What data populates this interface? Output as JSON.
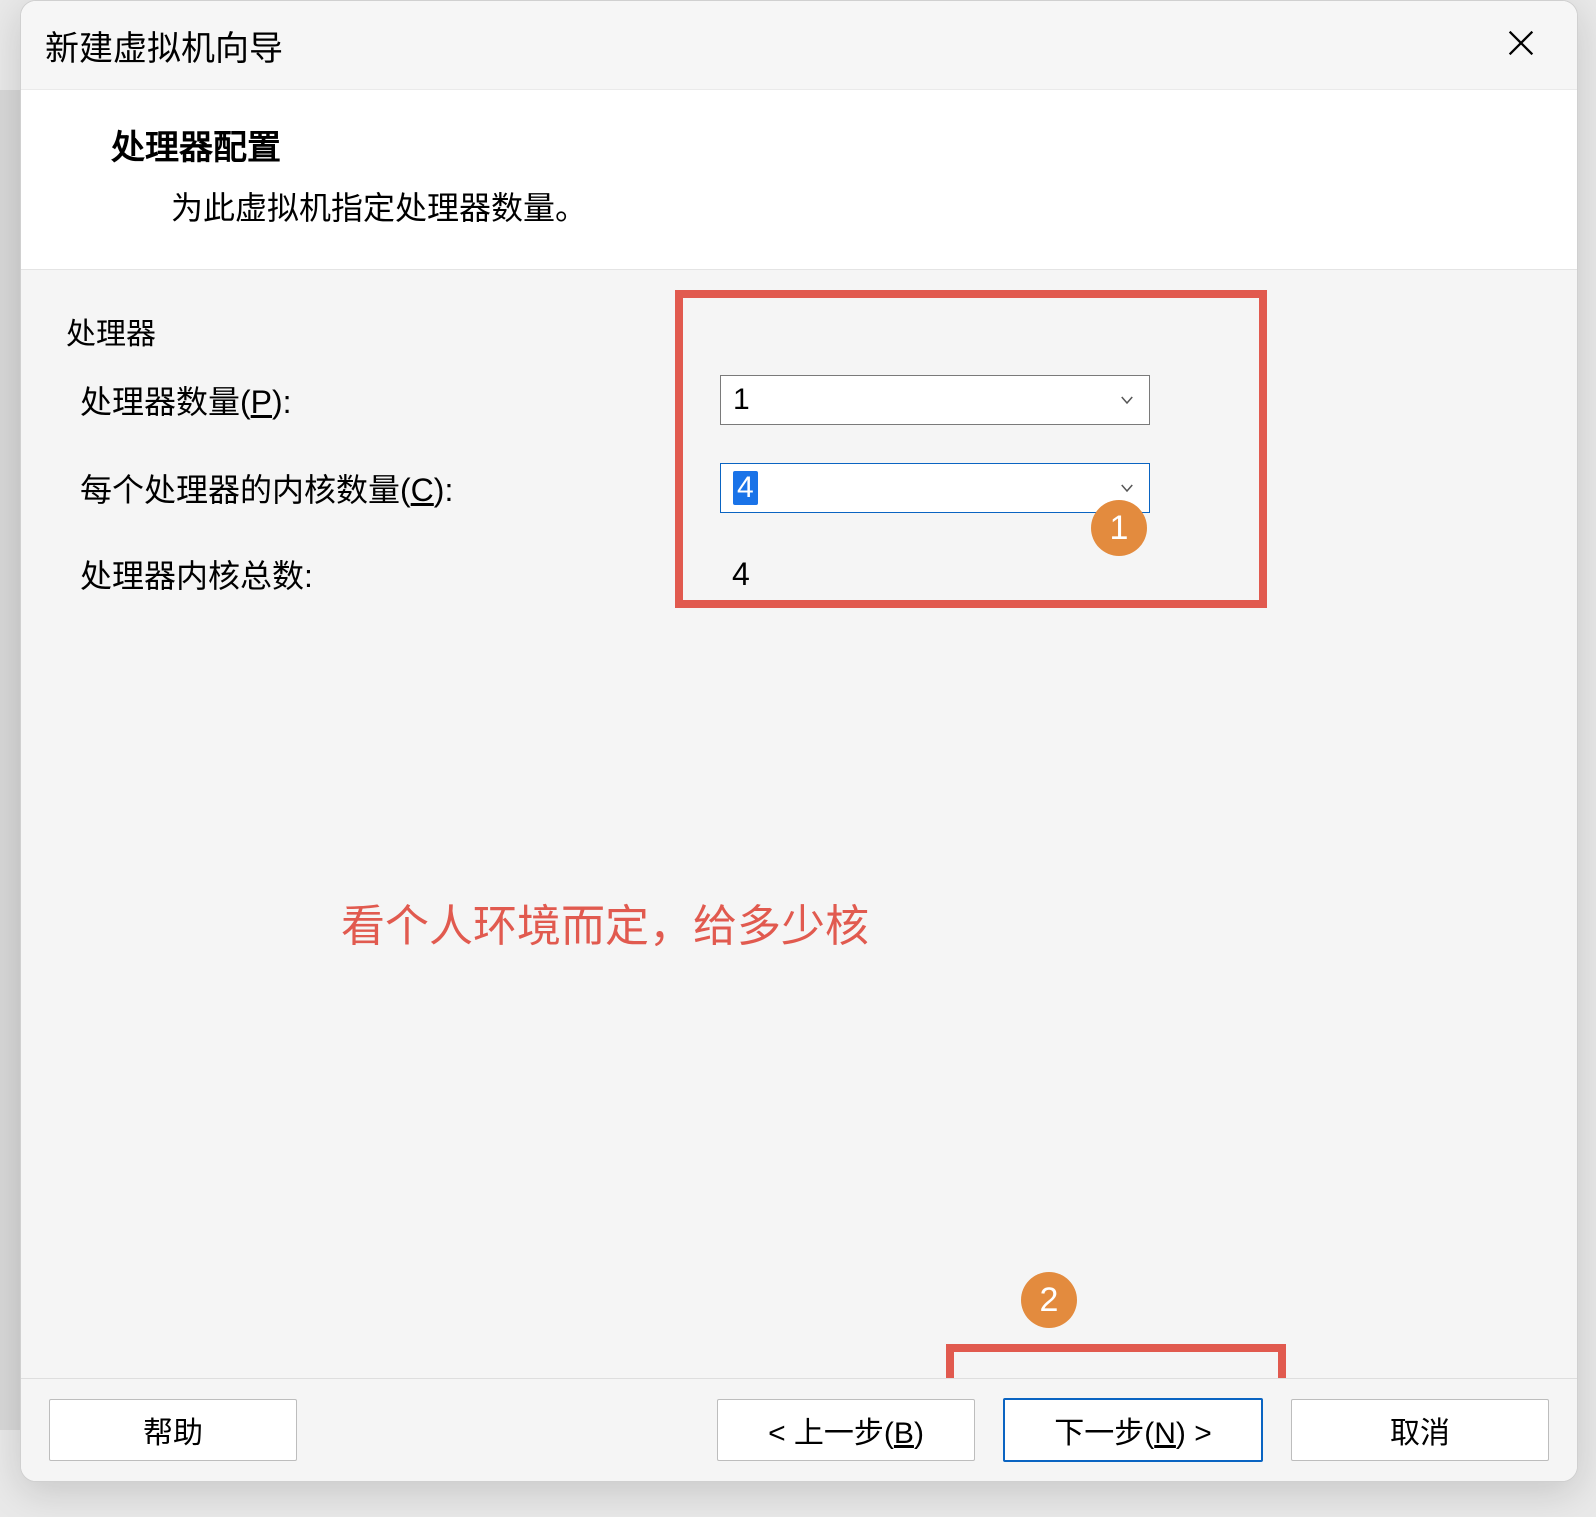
{
  "titlebar": {
    "title": "新建虚拟机向导"
  },
  "header": {
    "title": "处理器配置",
    "subtitle": "为此虚拟机指定处理器数量。"
  },
  "group": {
    "legend": "处理器",
    "rows": {
      "processors": {
        "label_pre": "处理器数量(",
        "label_key": "P",
        "label_post": "):",
        "value": "1"
      },
      "cores": {
        "label_pre": "每个处理器的内核数量(",
        "label_key": "C",
        "label_post": "):",
        "value": "4"
      },
      "total": {
        "label": "处理器内核总数:",
        "value": "4"
      }
    }
  },
  "annotations": {
    "hint": "看个人环境而定，给多少核",
    "badge1": "1",
    "badge2": "2"
  },
  "footer": {
    "help": "帮助",
    "back_pre": "< 上一步(",
    "back_key": "B",
    "back_post": ")",
    "next_pre": "下一步(",
    "next_key": "N",
    "next_post": ") >",
    "cancel": "取消"
  }
}
